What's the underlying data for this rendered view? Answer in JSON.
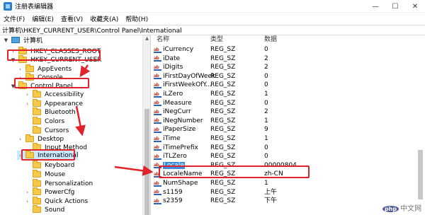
{
  "window": {
    "title": "注册表编辑器"
  },
  "menu": [
    "文件(F)",
    "编辑(E)",
    "查看(V)",
    "收藏夹(A)",
    "帮助(H)"
  ],
  "address": "计算机\\HKEY_CURRENT_USER\\Control Panel\\International",
  "tree": [
    {
      "label": "计算机",
      "expander": "▼",
      "icon": "computer-icon"
    },
    {
      "label": "HKEY_CLASSES_ROOT",
      "expander": "›",
      "icon": "folder-icon"
    },
    {
      "label": "HKEY_CURRENT_USER",
      "expander": "▼",
      "icon": "folder-icon"
    },
    {
      "label": "AppEvents",
      "expander": "›",
      "icon": "folder-icon"
    },
    {
      "label": "Console",
      "expander": "›",
      "icon": "folder-icon"
    },
    {
      "label": "Control Panel",
      "expander": "▼",
      "icon": "folder-icon"
    },
    {
      "label": "Accessibility",
      "expander": "›",
      "icon": "folder-icon"
    },
    {
      "label": "Appearance",
      "expander": "›",
      "icon": "folder-icon"
    },
    {
      "label": "Bluetooth",
      "expander": "",
      "icon": "folder-icon"
    },
    {
      "label": "Colors",
      "expander": "",
      "icon": "folder-icon"
    },
    {
      "label": "Cursors",
      "expander": "",
      "icon": "folder-icon"
    },
    {
      "label": "Desktop",
      "expander": "›",
      "icon": "folder-icon"
    },
    {
      "label": "Input Method",
      "expander": "",
      "icon": "folder-icon"
    },
    {
      "label": "International",
      "expander": "›",
      "icon": "folder-icon"
    },
    {
      "label": "Keyboard",
      "expander": "",
      "icon": "folder-icon"
    },
    {
      "label": "Mouse",
      "expander": "",
      "icon": "folder-icon"
    },
    {
      "label": "Personalization",
      "expander": "",
      "icon": "folder-icon"
    },
    {
      "label": "PowerCfg",
      "expander": "›",
      "icon": "folder-icon"
    },
    {
      "label": "Quick Actions",
      "expander": "›",
      "icon": "folder-icon"
    },
    {
      "label": "Sound",
      "expander": "",
      "icon": "folder-icon"
    }
  ],
  "columns": {
    "name": "名称",
    "type": "类型",
    "data": "数据"
  },
  "values": [
    {
      "name": "iCurrency",
      "type": "REG_SZ",
      "data": "0"
    },
    {
      "name": "iDate",
      "type": "REG_SZ",
      "data": "2"
    },
    {
      "name": "iDigits",
      "type": "REG_SZ",
      "data": "2"
    },
    {
      "name": "iFirstDayOfWeek",
      "type": "REG_SZ",
      "data": "0"
    },
    {
      "name": "iFirstWeekOfY...",
      "type": "REG_SZ",
      "data": "0"
    },
    {
      "name": "iLZero",
      "type": "REG_SZ",
      "data": "1"
    },
    {
      "name": "iMeasure",
      "type": "REG_SZ",
      "data": "0"
    },
    {
      "name": "iNegCurr",
      "type": "REG_SZ",
      "data": "2"
    },
    {
      "name": "iNegNumber",
      "type": "REG_SZ",
      "data": "1"
    },
    {
      "name": "iPaperSize",
      "type": "REG_SZ",
      "data": "9"
    },
    {
      "name": "iTime",
      "type": "REG_SZ",
      "data": "1"
    },
    {
      "name": "iTimePrefix",
      "type": "REG_SZ",
      "data": "0"
    },
    {
      "name": "iTLZero",
      "type": "REG_SZ",
      "data": "0"
    },
    {
      "name": "Locale",
      "type": "REG_SZ",
      "data": "00000804"
    },
    {
      "name": "LocaleName",
      "type": "REG_SZ",
      "data": "zh-CN"
    },
    {
      "name": "NumShape",
      "type": "REG_SZ",
      "data": "1"
    },
    {
      "name": "s1159",
      "type": "REG_SZ",
      "data": "上午"
    },
    {
      "name": "s2359",
      "type": "REG_SZ",
      "data": "下午"
    }
  ],
  "value_icon": "ab",
  "watermark": {
    "logo": "php",
    "text": "中文网"
  },
  "colors": {
    "annotation_red": "#e0232b",
    "selection": "#cce8ff",
    "selected_value": "#3b8ede"
  }
}
